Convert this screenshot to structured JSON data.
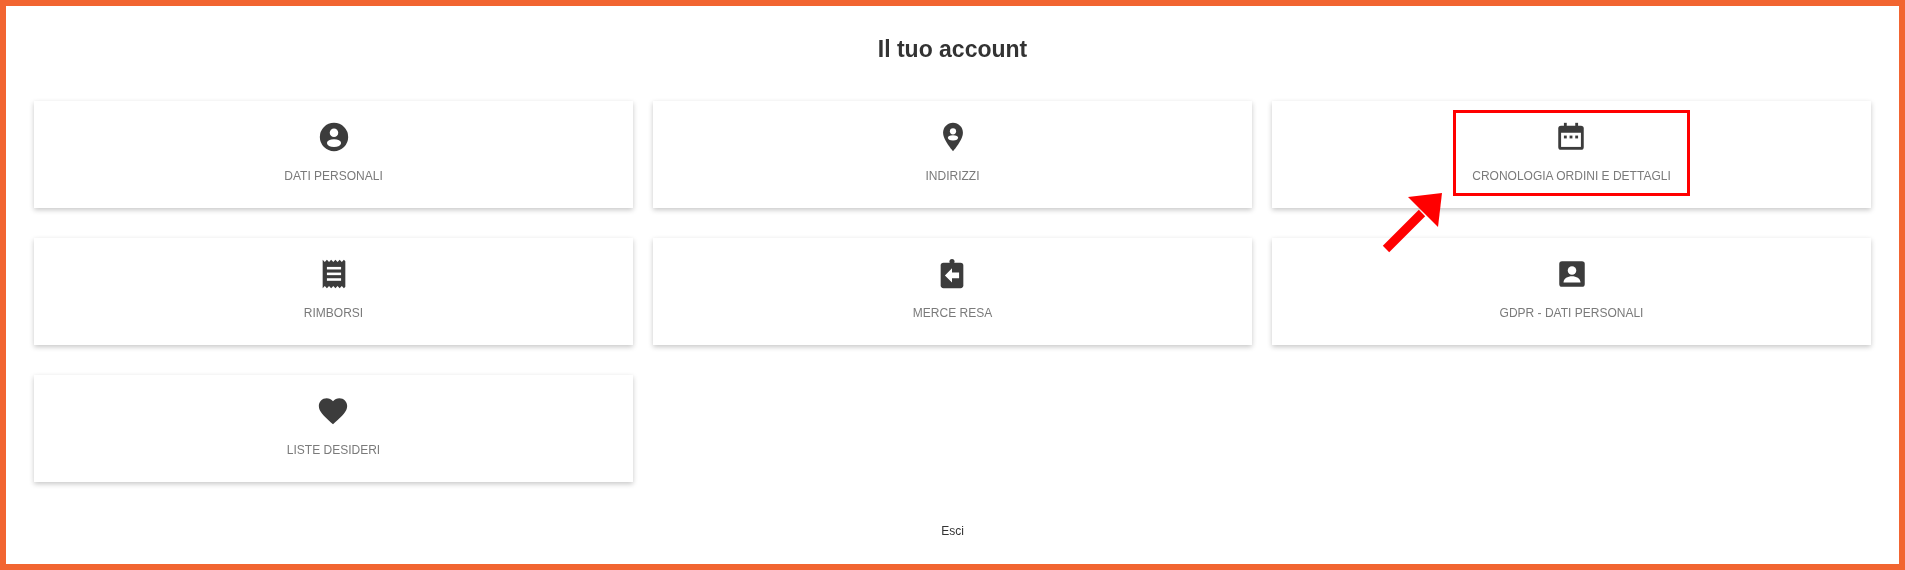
{
  "title": "Il tuo account",
  "cards": [
    {
      "label": "DATI PERSONALI",
      "highlighted": false
    },
    {
      "label": "INDIRIZZI",
      "highlighted": false
    },
    {
      "label": "CRONOLOGIA ORDINI E DETTAGLI",
      "highlighted": true
    },
    {
      "label": "RIMBORSI",
      "highlighted": false
    },
    {
      "label": "MERCE RESA",
      "highlighted": false
    },
    {
      "label": "GDPR - DATI PERSONALI",
      "highlighted": false
    },
    {
      "label": "LISTE DESIDERI",
      "highlighted": false
    }
  ],
  "logout": "Esci"
}
